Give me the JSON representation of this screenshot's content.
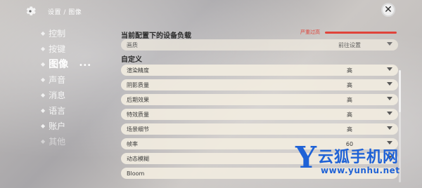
{
  "header": {
    "breadcrumb": "设置 / 图像",
    "close_symbol": "✕"
  },
  "sidebar": {
    "items": [
      {
        "label": "控制"
      },
      {
        "label": "按键"
      },
      {
        "label": "图像"
      },
      {
        "label": "声音"
      },
      {
        "label": "消息"
      },
      {
        "label": "语言"
      },
      {
        "label": "账户"
      },
      {
        "label": "其他"
      }
    ],
    "active_index": 2
  },
  "panel": {
    "device_load_title": "当前配置下的设备负载",
    "device_load_status": "严重过高",
    "preset_row": {
      "label": "画质",
      "value": "前往设置"
    },
    "custom_title": "自定义",
    "rows": [
      {
        "label": "渲染精度",
        "value": "高"
      },
      {
        "label": "阴影质量",
        "value": "高"
      },
      {
        "label": "后期效果",
        "value": "高"
      },
      {
        "label": "特效质量",
        "value": "高"
      },
      {
        "label": "场景细节",
        "value": "高"
      },
      {
        "label": "帧率",
        "value": "60"
      },
      {
        "label": "动态模糊",
        "value": ""
      },
      {
        "label": "Bloom",
        "value": ""
      }
    ]
  },
  "watermark": {
    "letter": "Y",
    "name": "云狐手机网",
    "url": "www.yunhu.net"
  },
  "colors": {
    "accent_red": "#e0433a",
    "watermark_blue": "#1f62d6",
    "row_bg": "#f1ebdf"
  }
}
